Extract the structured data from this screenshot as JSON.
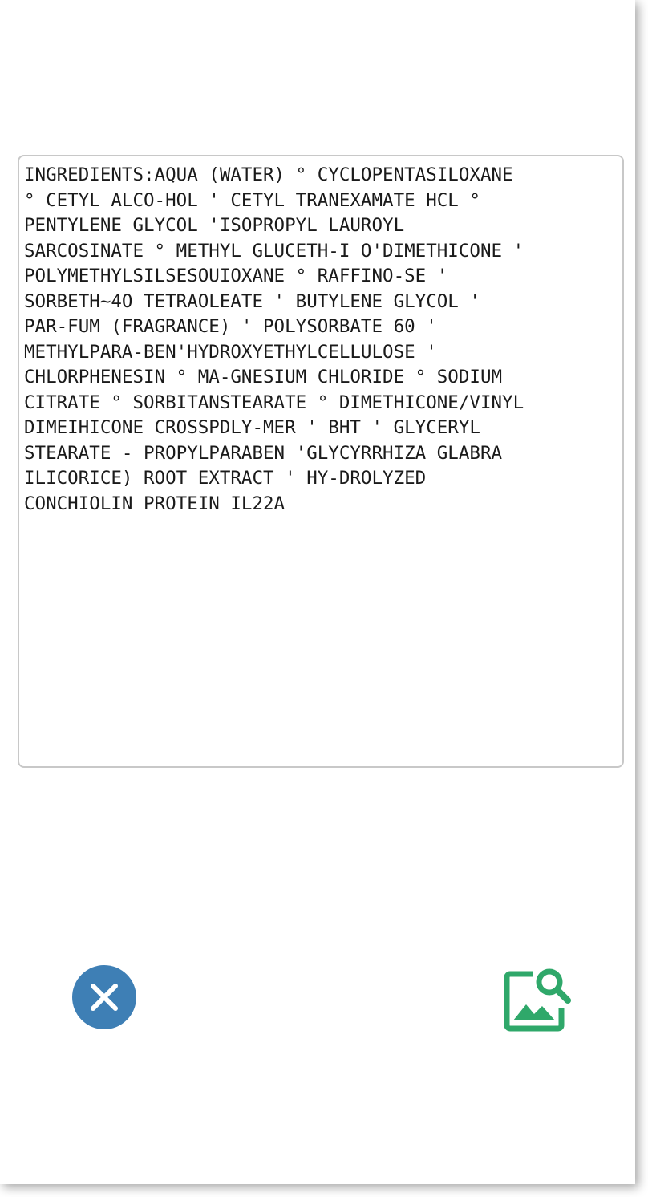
{
  "ocr_result": {
    "lines": [
      "INGREDIENTS:AQUA (WATER) ° CYCLOPENTASILOXANE",
      "° CETYL ALCO-HOL ' CETYL TRANEXAMATE HCL °",
      "PENTYLENE GLYCOL 'ISOPROPYL LAUROYL",
      "SARCOSINATE ° METHYL GLUCETH-I O'DIMETHICONE '",
      "POLYMETHYLSILSESOUIOXANE ° RAFFINO-SE '",
      "SORBETH~4O TETRAOLEATE ' BUTYLENE GLYCOL '",
      "PAR-FUM (FRAGRANCE) ' POLYSORBATE 60 '",
      "METHYLPARA-BEN'HYDROXYETHYLCELLULOSE '",
      "CHLORPHENESIN ° MA-GNESIUM CHLORIDE ° SODIUM",
      "CITRATE ° SORBITANSTEARATE ° DIMETHICONE/VINYL",
      "DIMEIHICONE CROSSPDLY-MER ' BHT ' GLYCERYL",
      "STEARATE - PROPYLPARABEN 'GLYCYRRHIZA GLABRA",
      "ILICORICE) ROOT EXTRACT ' HY-DROLYZED",
      "CONCHIOLIN PROTEIN IL22A"
    ]
  },
  "actions": {
    "close": {
      "icon": "close-icon",
      "color": "#3e7fb5"
    },
    "image_search": {
      "icon": "image-search-icon",
      "color": "#2fa86a"
    }
  }
}
